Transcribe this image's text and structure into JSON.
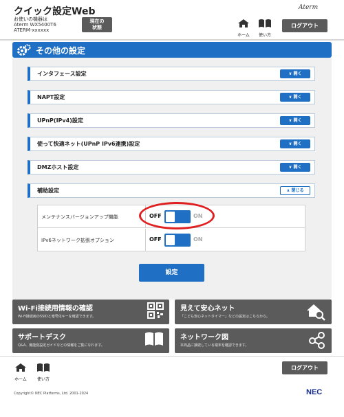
{
  "header": {
    "app_title": "クイック設定Web",
    "device_caption": "お使いの機器は",
    "device_model": "Aterm WX5400T6",
    "device_ssid": "ATERM-xxxxxx",
    "status_button": "現在の\n状態",
    "brand": "Aterm",
    "home_label": "ホーム",
    "manual_label": "使い方",
    "logout_label": "ログアウト"
  },
  "section": {
    "title": "その他の設定",
    "accordions": [
      {
        "title": "インタフェース設定",
        "button": "開く"
      },
      {
        "title": "NAPT設定",
        "button": "開く"
      },
      {
        "title": "UPnP(IPv4)設定",
        "button": "開く"
      },
      {
        "title": "使って快適ネット(UPnP IPv6連携)設定",
        "button": "開く"
      },
      {
        "title": "DMZホスト設定",
        "button": "開く"
      },
      {
        "title": "補助設定",
        "button": "閉じる"
      }
    ],
    "details": [
      {
        "label": "メンテナンスバージョンアップ機能",
        "off": "OFF",
        "on": "ON"
      },
      {
        "label": "IPv6ネットワーク拡張オプション",
        "off": "OFF",
        "on": "ON"
      }
    ],
    "apply_button": "設定"
  },
  "tiles": [
    {
      "title": "Wi-Fi接続用情報の確認",
      "sub": "Wi-Fi接続用のSSIDと暗号化キーを確認できます。"
    },
    {
      "title": "見えて安心ネット",
      "sub": "「こども安心ネットタイマー」などの設定はこちらから。"
    },
    {
      "title": "サポートデスク",
      "sub": "Q&A、機能別設定ガイドなどの情報をご覧になれます。"
    },
    {
      "title": "ネットワーク図",
      "sub": "本商品に接続している端末を確認できます。"
    }
  ],
  "footer": {
    "home_label": "ホーム",
    "manual_label": "使い方",
    "logout_label": "ログアウト",
    "copyright": "Copyright© NEC Platforms, Ltd. 2001-2024",
    "nec": "NEC"
  },
  "colors": {
    "accent": "#1f6fc5",
    "tile": "#5b5b5b",
    "highlight": "#e02020"
  }
}
